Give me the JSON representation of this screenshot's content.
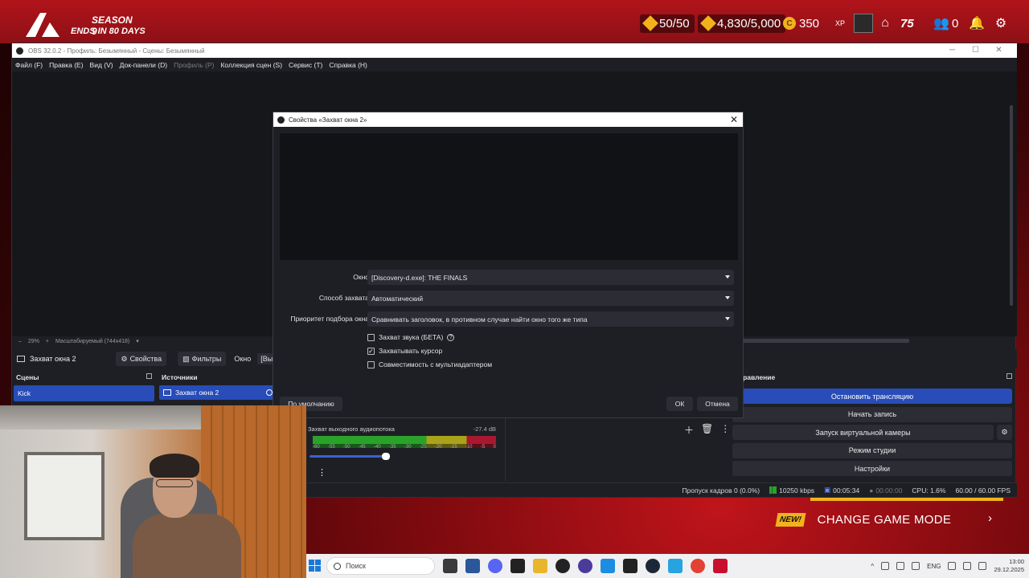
{
  "game": {
    "season_title": "SEASON 9",
    "season_sub": "ENDS IN 80 DAYS",
    "stats": {
      "vrs": "50/50",
      "multibucks": "4,830/5,000",
      "coins": "350",
      "xp_label": "XP",
      "level": "75",
      "friends": "0"
    },
    "cgm_new": "NEW!",
    "cgm_label": "CHANGE GAME MODE",
    "cgm_arrow": "›"
  },
  "obs": {
    "window_title": "OBS 32.0.2 - Профиль: Безымянный - Сцены: Безымянный",
    "menu": [
      {
        "label": "Файл (F)",
        "enabled": true
      },
      {
        "label": "Правка (E)",
        "enabled": true
      },
      {
        "label": "Вид (V)",
        "enabled": true
      },
      {
        "label": "Док-панели (D)",
        "enabled": true
      },
      {
        "label": "Профиль (P)",
        "enabled": false
      },
      {
        "label": "Коллекция сцен (S)",
        "enabled": true
      },
      {
        "label": "Сервис (T)",
        "enabled": true
      },
      {
        "label": "Справка (H)",
        "enabled": true
      }
    ],
    "zoom": {
      "minus": "–",
      "value": "29%",
      "plus": "+",
      "mode": "Масштабируемый (744x418)"
    },
    "source_bar": {
      "current_source": "Захват окна 2",
      "properties": "Свойства",
      "filters": "Фильтры",
      "window_label": "Окно",
      "window_value": "[Выбо"
    },
    "docks": {
      "scenes_title": "Сцены",
      "sources_title": "Источники",
      "controls_title": "Управление"
    },
    "scenes": [
      "Kick"
    ],
    "sources": [
      "Захват окна 2"
    ],
    "mixer": {
      "name": "Захват выходного аудиопотока",
      "db": "-27.4 dB",
      "scale": [
        "-60",
        "-55",
        "-50",
        "-45",
        "-40",
        "-35",
        "-30",
        "-25",
        "-20",
        "-15",
        "-10",
        "-5",
        "0"
      ],
      "dots": "⋮"
    },
    "controls": {
      "stop_stream": "Остановить трансляцию",
      "start_record": "Начать запись",
      "virtual_cam": "Запуск виртуальной камеры",
      "studio_mode": "Режим студии",
      "settings": "Настройки"
    },
    "status": {
      "dropped": "Пропуск кадров 0 (0.0%)",
      "bitrate": "10250 kbps",
      "stream_time": "00:05:34",
      "rec_time": "00:00:00",
      "cpu": "CPU: 1.6%",
      "fps": "60.00 / 60.00 FPS"
    }
  },
  "dialog": {
    "title": "Свойства «Захват окна 2»",
    "close": "✕",
    "fields": {
      "window_label": "Окно",
      "window_value": "[Discovery-d.exe]: THE FINALS",
      "method_label": "Способ захвата",
      "method_value": "Автоматический",
      "priority_label": "Приоритет подбора окна",
      "priority_value": "Сравнивать заголовок, в противном случае найти окно того же типа"
    },
    "checkboxes": {
      "audio_label": "Захват звука (БЕТА)",
      "audio_checked": false,
      "cursor_label": "Захватывать курсор",
      "cursor_checked": true,
      "multiadapter_label": "Совместимость с мультиадаптером",
      "multiadapter_checked": false
    },
    "buttons": {
      "defaults": "По умолчанию",
      "ok": "ОК",
      "cancel": "Отмена"
    }
  },
  "taskbar": {
    "search_placeholder": "Поиск",
    "lang": "ENG",
    "time": "13:00",
    "date": "29.12.2025"
  },
  "colors": {
    "accent": "#284cb8",
    "obs_bg": "#1e1f25",
    "game_red": "#b0141a",
    "gold": "#f2b21c"
  }
}
